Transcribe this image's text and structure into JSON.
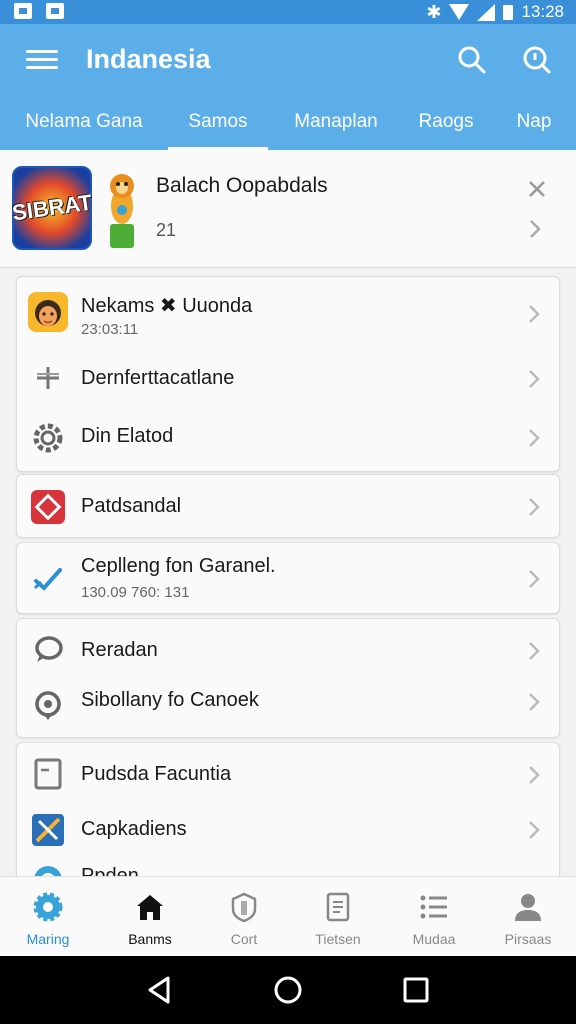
{
  "status_bar": {
    "time": "13:28"
  },
  "app_bar": {
    "title": "Indanesia",
    "tabs": [
      "Nelama Gana",
      "Samos",
      "Manaplan",
      "Raogs",
      "Nap"
    ]
  },
  "notification": {
    "title": "Balach Oopabdals",
    "subtitle": "21",
    "game_icon_text": "SIBRAT"
  },
  "list": {
    "card1": [
      {
        "label": "Nekams ✖ Uuonda",
        "sub": "23:03:11",
        "icon": "avatar-icon"
      },
      {
        "label": "Dernferttacatlane",
        "icon": "plus-icon"
      },
      {
        "label": "Din Elatod",
        "icon": "gear-icon"
      }
    ],
    "card2": [
      {
        "label": "Patdsandal",
        "icon": "diamond-icon"
      }
    ],
    "card3": [
      {
        "label": "Ceplleng fon Garanel.",
        "sub": "130.09 760: 131",
        "icon": "check-icon"
      }
    ],
    "card4": [
      {
        "label": "Reradan",
        "icon": "chat-icon"
      },
      {
        "label": "Sibollany fo Canoek",
        "icon": "location-icon"
      }
    ],
    "card5": [
      {
        "label": "Pudsda Facuntia",
        "icon": "document-icon"
      },
      {
        "label": "Capkadiens",
        "icon": "tools-icon"
      },
      {
        "label": "Ppden",
        "icon": "globe-icon"
      }
    ]
  },
  "bottom_nav": [
    {
      "label": "Maring",
      "icon": "settings-icon",
      "active": true
    },
    {
      "label": "Banms",
      "icon": "home-icon"
    },
    {
      "label": "Cort",
      "icon": "shield-icon"
    },
    {
      "label": "Tietsen",
      "icon": "file-icon"
    },
    {
      "label": "Mudaa",
      "icon": "list-icon"
    },
    {
      "label": "Pirsaas",
      "icon": "person-icon"
    }
  ],
  "colors": {
    "primary": "#5caee8",
    "status": "#3a8fd9",
    "accent": "#2b8fd6"
  }
}
